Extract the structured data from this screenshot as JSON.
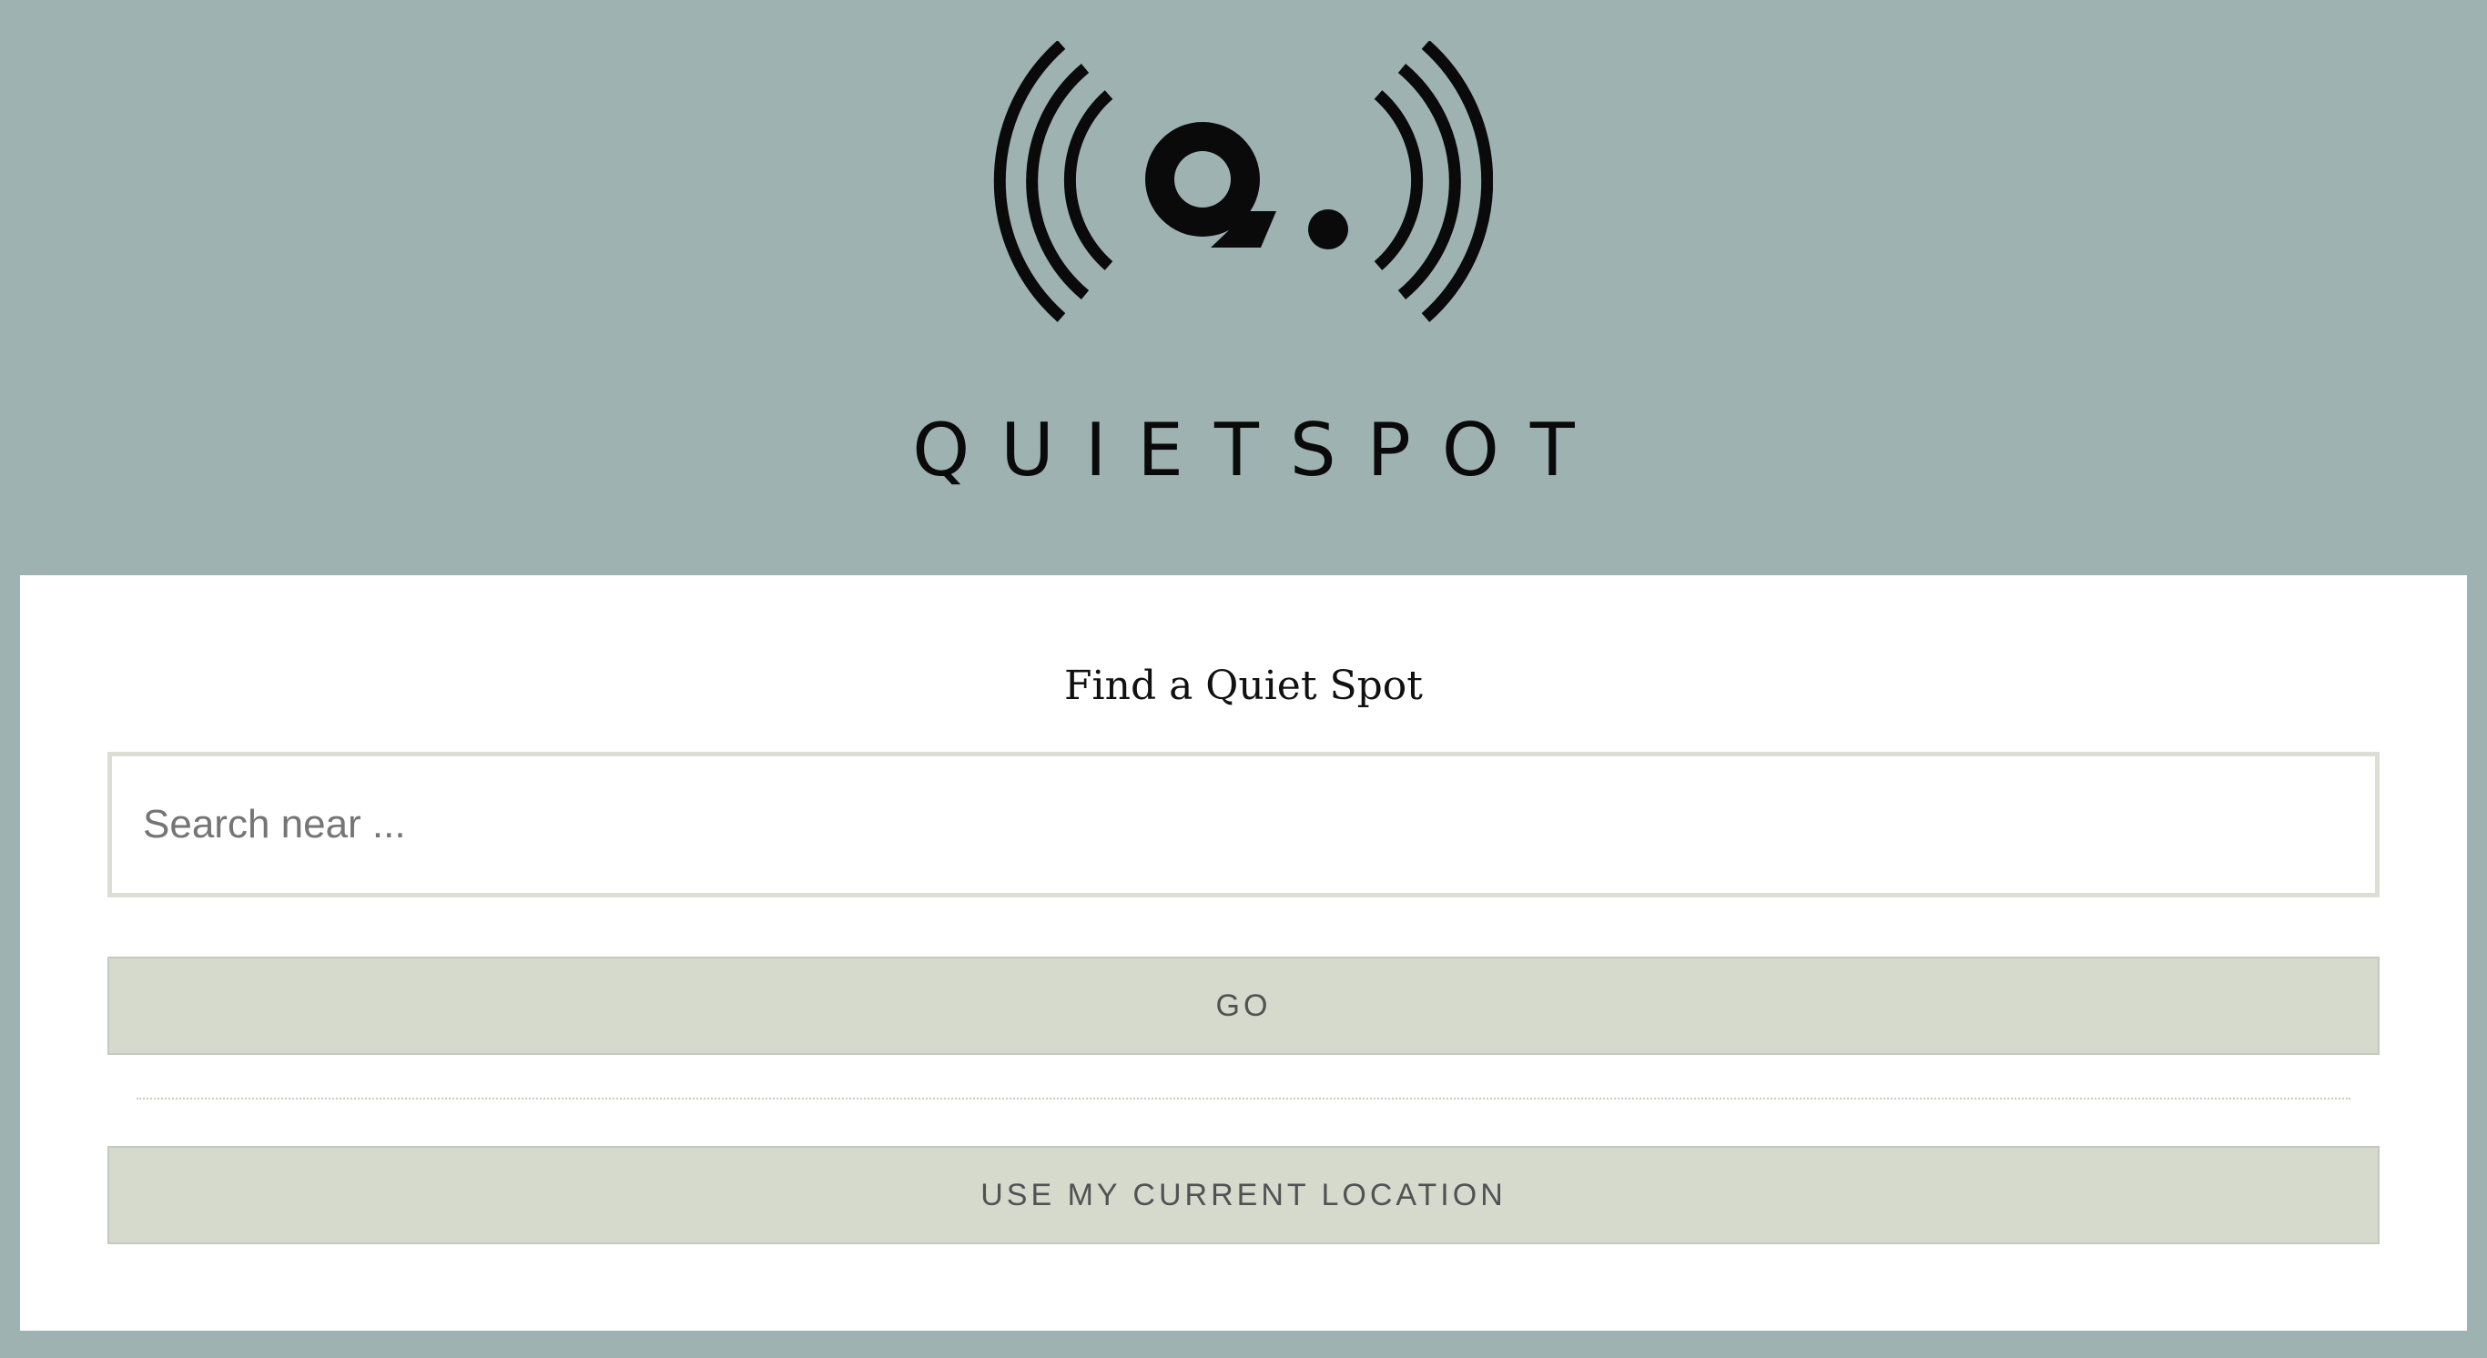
{
  "brand": {
    "logo_icon": "broadcast-q-logo-icon",
    "name": "QUIETSPOT"
  },
  "search_panel": {
    "title": "Find a Quiet Spot",
    "search_input": {
      "value": "",
      "placeholder": "Search near ..."
    },
    "go_label": "GO",
    "location_label": "USE MY CURRENT LOCATION"
  },
  "colors": {
    "page_background": "#9eb2b1",
    "card_background": "#ffffff",
    "button_background": "#d5dacd",
    "button_text": "#505353",
    "logo": "#0a0a0a"
  }
}
